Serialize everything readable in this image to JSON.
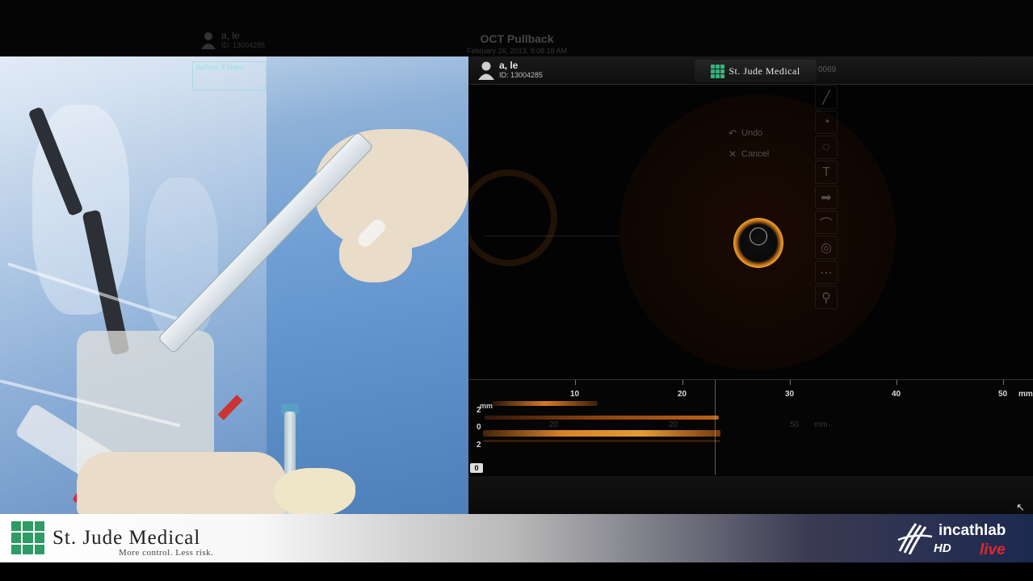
{
  "ghost_header": {
    "user_name": "a, le",
    "user_id": "ID: 13004285",
    "title": "OCT Pullback",
    "date": "February 26, 2013, 9:08:18 AM"
  },
  "camera": {
    "overlay_text": "Surface: 8 Matrix"
  },
  "oct": {
    "patient_name": "a, le",
    "patient_id": "ID: 13004285",
    "brand": "St. Jude Medical",
    "header_code": "0069",
    "edit_menu": [
      {
        "icon": "undo-icon",
        "label": "Undo"
      },
      {
        "icon": "cancel-icon",
        "label": "Cancel"
      }
    ],
    "toolbar": [
      {
        "icon": "pen-icon",
        "glyph": "╱"
      },
      {
        "icon": "circle-measure-icon",
        "glyph": "◔"
      },
      {
        "icon": "area-icon",
        "glyph": "◌"
      },
      {
        "icon": "text-icon",
        "glyph": "T"
      },
      {
        "icon": "arrow-icon",
        "glyph": "➡"
      },
      {
        "icon": "ruler-icon",
        "glyph": "⌒"
      },
      {
        "icon": "view-icon",
        "glyph": "◎"
      },
      {
        "icon": "measure-icon",
        "glyph": "⋯"
      },
      {
        "icon": "zoom-icon",
        "glyph": "⚲"
      }
    ],
    "lview": {
      "x_ticks": [
        "10",
        "20",
        "30",
        "40",
        "50"
      ],
      "x_unit": "mm",
      "y_unit": "mm",
      "y_ticks": [
        "2",
        "0",
        "2"
      ],
      "zero_badge": "0",
      "ghost_numbers": [
        "20",
        "20",
        "50",
        "mm",
        "20"
      ]
    }
  },
  "branding": {
    "sjm_name": "St. Jude Medical",
    "sjm_tagline": "More control. Less risk.",
    "incathlab": "incathlab",
    "hd": "HD",
    "live": "live"
  },
  "colors": {
    "sjm_green": "#2e9c64",
    "oct_orange": "#f2a428",
    "live_red": "#e2262c"
  }
}
